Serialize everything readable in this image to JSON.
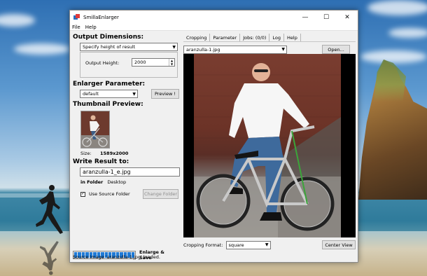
{
  "window": {
    "title": "SmillaEnlarger"
  },
  "menu": [
    "File",
    "Help"
  ],
  "left": {
    "output_dimensions": {
      "heading": "Output Dimensions:",
      "mode": "Specify height of result",
      "height_label": "Output Height:",
      "height_value": "2000"
    },
    "enlarger": {
      "heading": "Enlarger Parameter:",
      "preset": "default",
      "preview_button": "Preview !"
    },
    "thumbnail": {
      "heading": "Thumbnail Preview:",
      "size_label": "Size:",
      "size_value": "1589x2000"
    },
    "write": {
      "heading": "Write Result to:",
      "filename": "aranzulla-1_e.jpg",
      "in_folder_label": "in Folder",
      "folder": "Desktop",
      "use_source_label": "Use Source Folder",
      "use_source_checked": true,
      "change_folder_button": "Change Folder"
    },
    "progress": {
      "value": 1.0,
      "segments": 16
    },
    "enlarge_button": "Enlarge & Save",
    "status": "Source image 'aranzulla-1.jpg' loaded."
  },
  "right": {
    "tabs": [
      "Cropping",
      "Parameter",
      "Jobs: (0/0)",
      "Log",
      "Help"
    ],
    "active_tab": "Cropping",
    "source_file": "aranzulla-1.jpg",
    "open_button": "Open...",
    "cropping_format_label": "Cropping Format:",
    "cropping_format": "square",
    "center_view_button": "Center View"
  }
}
